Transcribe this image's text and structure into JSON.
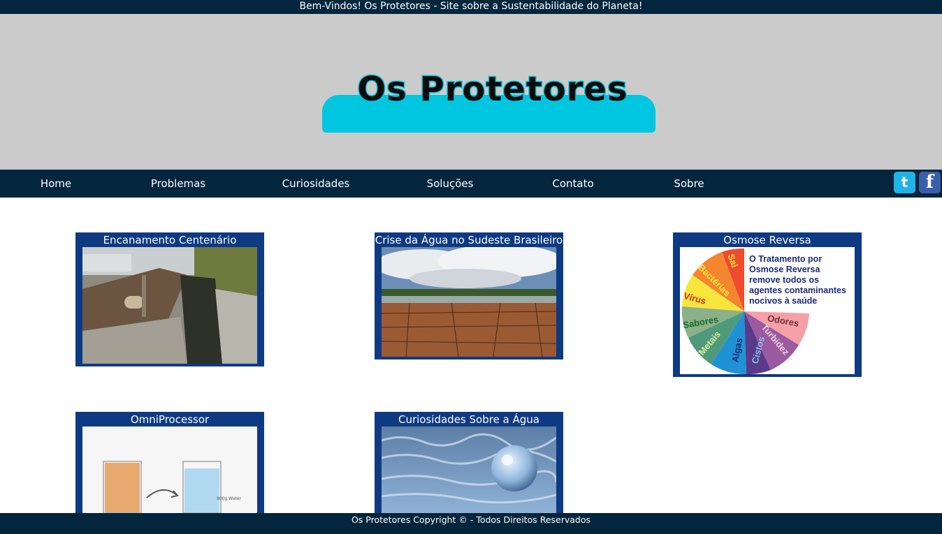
{
  "topbar": {
    "text": "Bem-Vindos! Os Protetores - Site sobre a Sustentabilidade do Planeta!"
  },
  "banner": {
    "logo_text": "Os Protetores"
  },
  "nav": {
    "items": [
      {
        "label": "Home"
      },
      {
        "label": "Problemas"
      },
      {
        "label": "Curiosidades"
      },
      {
        "label": "Soluções"
      },
      {
        "label": "Contato"
      },
      {
        "label": "Sobre"
      }
    ],
    "social": [
      {
        "icon": "twitter-icon",
        "glyph": "t"
      },
      {
        "icon": "facebook-icon",
        "glyph": "f"
      }
    ]
  },
  "cards": [
    {
      "title": "Encanamento Centenário"
    },
    {
      "title": "Crise da Água no Sudeste Brasileiro"
    },
    {
      "title": "Osmose Reversa",
      "image_text": {
        "caption": [
          "O Tratamento por",
          "Osmose Reversa",
          "remove todos os",
          "agentes contaminantes",
          "nocivos à saúde"
        ],
        "slices": [
          "Sal",
          "Bactérias",
          "Vírus",
          "Sabores",
          "Metais",
          "Algas",
          "Cistos",
          "Turbidez",
          "Odores"
        ]
      }
    },
    {
      "title": "OmniProcessor",
      "image_text": {
        "beaker_label": "800g Water"
      }
    },
    {
      "title": "Curiosidades Sobre a Água"
    }
  ],
  "footer": {
    "text": "Os Protetores Copyright © - Todos Direitos Reservados"
  },
  "colors": {
    "dark_navy": "#03263d",
    "card_blue": "#0e3a82",
    "banner_gray": "#cbcbcb",
    "logo_cyan": "#00c6e0"
  }
}
